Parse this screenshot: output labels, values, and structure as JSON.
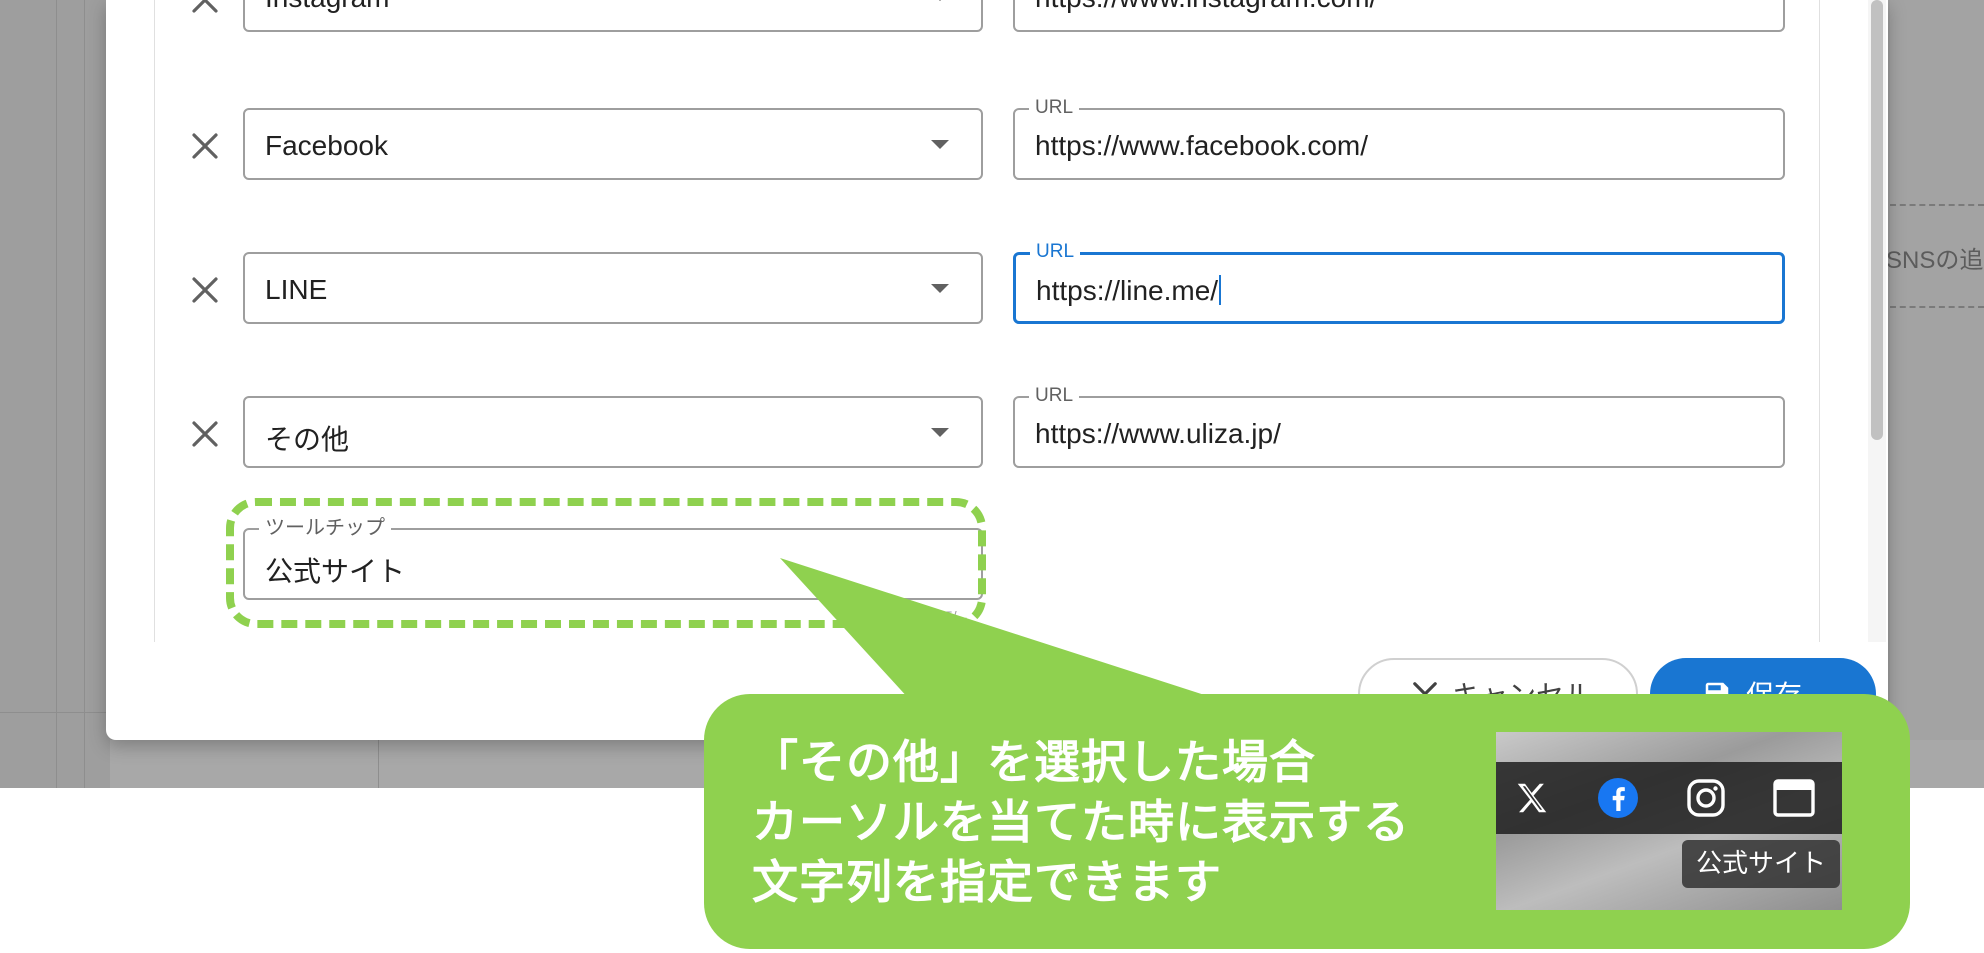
{
  "links": [
    {
      "platform": "Instagram",
      "url_label": "",
      "url": "https://www.instagram.com/"
    },
    {
      "platform": "Facebook",
      "url_label": "URL",
      "url": "https://www.facebook.com/"
    },
    {
      "platform": "LINE",
      "url_label": "URL",
      "url": "https://line.me/"
    },
    {
      "platform": "その他",
      "url_label": "URL",
      "url": "https://www.uliza.jp/"
    }
  ],
  "tooltip_field": {
    "label": "ツールチップ",
    "value": "公式サイト",
    "counter": "5/..."
  },
  "buttons": {
    "cancel": "キャンセル",
    "save": "保存"
  },
  "background": {
    "sns_add_label": "SNSの追"
  },
  "callout": {
    "text": "「その他」を選択した場合\nカーソルを当てた時に表示する\n文字列を指定できます",
    "color": "#8fd14f",
    "preview_tooltip": "公式サイト",
    "preview_icons": [
      "x-icon",
      "facebook-icon",
      "instagram-icon",
      "browser-window-icon"
    ]
  },
  "colors": {
    "focus": "#1976d2",
    "save_button": "#1976d2",
    "highlight": "#8fd14f"
  }
}
